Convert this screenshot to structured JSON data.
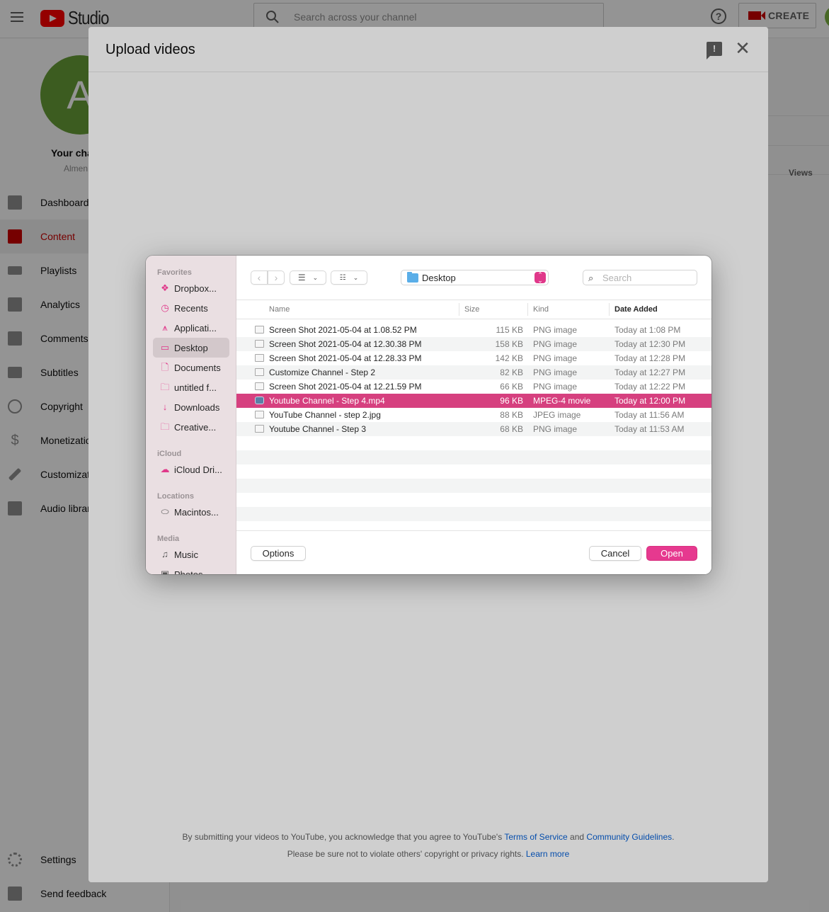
{
  "app": {
    "logo_text": "Studio",
    "search_placeholder": "Search across your channel",
    "create_label": "CREATE",
    "channel": {
      "avatar_letter": "A",
      "your_channel_label": "Your channel",
      "channel_name": "Almen"
    },
    "nav": [
      {
        "label": "Dashboard",
        "icon": "dashboard-icon",
        "active": false
      },
      {
        "label": "Content",
        "icon": "content-icon",
        "active": true
      },
      {
        "label": "Playlists",
        "icon": "playlists-icon",
        "active": false
      },
      {
        "label": "Analytics",
        "icon": "analytics-icon",
        "active": false
      },
      {
        "label": "Comments",
        "icon": "comments-icon",
        "active": false
      },
      {
        "label": "Subtitles",
        "icon": "subtitles-icon",
        "active": false
      },
      {
        "label": "Copyright",
        "icon": "copyright-icon",
        "active": false
      },
      {
        "label": "Monetization",
        "icon": "monetization-icon",
        "active": false
      },
      {
        "label": "Customization",
        "icon": "customization-icon",
        "active": false
      },
      {
        "label": "Audio library",
        "icon": "audio-library-icon",
        "active": false
      }
    ],
    "nav_bottom": [
      {
        "label": "Settings",
        "icon": "gear-icon"
      },
      {
        "label": "Send feedback",
        "icon": "feedback-icon"
      }
    ],
    "table_header_views": "Views"
  },
  "upload_modal": {
    "title": "Upload videos",
    "legal_line1_prefix": "By submitting your videos to YouTube, you acknowledge that you agree to YouTube's ",
    "terms_link": "Terms of Service",
    "legal_and": " and ",
    "guidelines_link": "Community Guidelines",
    "legal_line1_suffix": ".",
    "legal_line2_prefix": "Please be sure not to violate others' copyright or privacy rights. ",
    "learn_more_link": "Learn more"
  },
  "file_dialog": {
    "accent": "#e6398f",
    "selected_row_color": "#d6407f",
    "sidebar": {
      "sections": [
        {
          "title": "Favorites",
          "items": [
            {
              "label": "Dropbox...",
              "icon": "dropbox-icon",
              "selected": false
            },
            {
              "label": "Recents",
              "icon": "clock-icon",
              "selected": false
            },
            {
              "label": "Applicati...",
              "icon": "applications-icon",
              "selected": false
            },
            {
              "label": "Desktop",
              "icon": "desktop-icon",
              "selected": true
            },
            {
              "label": "Documents",
              "icon": "document-icon",
              "selected": false
            },
            {
              "label": "untitled f...",
              "icon": "folder-icon",
              "selected": false
            },
            {
              "label": "Downloads",
              "icon": "download-icon",
              "selected": false
            },
            {
              "label": "Creative...",
              "icon": "folder-icon",
              "selected": false
            }
          ]
        },
        {
          "title": "iCloud",
          "items": [
            {
              "label": "iCloud Dri...",
              "icon": "cloud-icon",
              "selected": false
            }
          ]
        },
        {
          "title": "Locations",
          "items": [
            {
              "label": "Macintos...",
              "icon": "drive-icon",
              "selected": false
            }
          ]
        },
        {
          "title": "Media",
          "items": [
            {
              "label": "Music",
              "icon": "music-icon",
              "selected": false
            },
            {
              "label": "Photos",
              "icon": "camera-icon",
              "selected": false
            }
          ]
        }
      ]
    },
    "location": "Desktop",
    "search_placeholder": "Search",
    "columns": {
      "name": "Name",
      "size": "Size",
      "kind": "Kind",
      "date": "Date Added"
    },
    "files": [
      {
        "name": "Screen Shot 2021-05-04 at 1.08.52 PM",
        "size": "115 KB",
        "kind": "PNG image",
        "date": "Today at 1:08 PM",
        "selected": false
      },
      {
        "name": "Screen Shot 2021-05-04 at 12.30.38 PM",
        "size": "158 KB",
        "kind": "PNG image",
        "date": "Today at 12:30 PM",
        "selected": false
      },
      {
        "name": "Screen Shot 2021-05-04 at 12.28.33 PM",
        "size": "142 KB",
        "kind": "PNG image",
        "date": "Today at 12:28 PM",
        "selected": false
      },
      {
        "name": "Customize Channel - Step 2",
        "size": "82 KB",
        "kind": "PNG image",
        "date": "Today at 12:27 PM",
        "selected": false
      },
      {
        "name": "Screen Shot 2021-05-04 at 12.21.59 PM",
        "size": "66 KB",
        "kind": "PNG image",
        "date": "Today at 12:22 PM",
        "selected": false
      },
      {
        "name": "Youtube Channel - Step 4.mp4",
        "size": "96 KB",
        "kind": "MPEG-4 movie",
        "date": "Today at 12:00 PM",
        "selected": true
      },
      {
        "name": "YouTube Channel - step 2.jpg",
        "size": "88 KB",
        "kind": "JPEG image",
        "date": "Today at 11:56 AM",
        "selected": false
      },
      {
        "name": "Youtube Channel - Step 3",
        "size": "68 KB",
        "kind": "PNG image",
        "date": "Today at 11:53 AM",
        "selected": false
      }
    ],
    "buttons": {
      "options": "Options",
      "cancel": "Cancel",
      "open": "Open"
    }
  }
}
